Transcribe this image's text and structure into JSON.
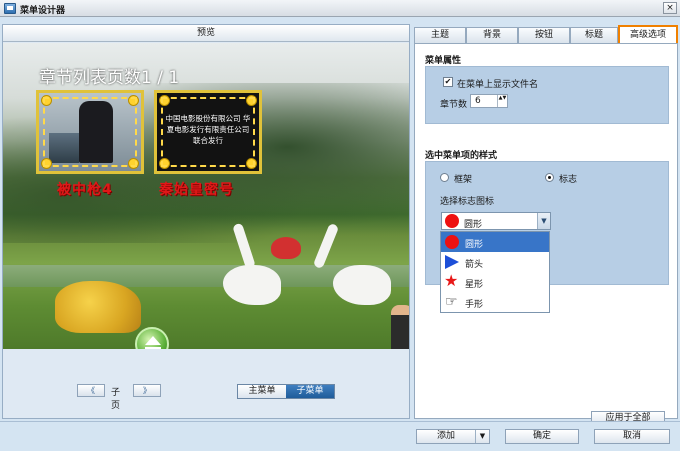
{
  "window": {
    "title": "菜单设计器",
    "close_glyph": "×"
  },
  "preview": {
    "header": "预览",
    "page_title": "章节列表页数1 / 1",
    "thumbnails": [
      {
        "caption": "被中枪4"
      },
      {
        "caption": "秦始皇密号",
        "text": "中国电影股份有限公司 华夏电影发行有限责任公司 联合发行"
      }
    ],
    "pager": {
      "prev_glyph": "《",
      "label": "子页",
      "next_glyph": "》"
    },
    "menu_toggle": {
      "main": "主菜单",
      "sub": "子菜单",
      "active": "sub"
    }
  },
  "tabs": [
    {
      "label": "主题"
    },
    {
      "label": "背景"
    },
    {
      "label": "按钮"
    },
    {
      "label": "标题"
    },
    {
      "label": "高级选项",
      "active": true
    }
  ],
  "menu_props": {
    "section_title": "菜单属性",
    "show_filename": {
      "label": "在菜单上显示文件名",
      "checked": true,
      "check_glyph": "✔"
    },
    "chapter_count": {
      "label": "章节数",
      "value": "6",
      "spin_glyph": "▲▼"
    }
  },
  "selected_style": {
    "section_title": "选中菜单项的样式",
    "options": [
      {
        "label": "框架",
        "selected": false
      },
      {
        "label": "标志",
        "selected": true
      }
    ],
    "icon_label": "选择标志图标",
    "combo": {
      "value": "圆形",
      "chevron_glyph": "▼"
    },
    "dropdown": [
      {
        "label": "圆形",
        "icon": "circle-icon",
        "color": "#ee1111",
        "selected": true
      },
      {
        "label": "箭头",
        "icon": "arrow-icon",
        "color": "#1c4fd8"
      },
      {
        "label": "星形",
        "icon": "star-icon",
        "glyph": "★",
        "color": "#e81818"
      },
      {
        "label": "手形",
        "icon": "hand-icon",
        "glyph": "☞"
      }
    ],
    "apply_all": "应用于全部"
  },
  "footer": {
    "add": "添加",
    "add_drop_glyph": "▼",
    "ok": "确定",
    "cancel": "取消"
  },
  "colors": {
    "accent_tab_border": "#f08000",
    "selected_blue": "#3875c8",
    "title_red": "#e01818"
  }
}
